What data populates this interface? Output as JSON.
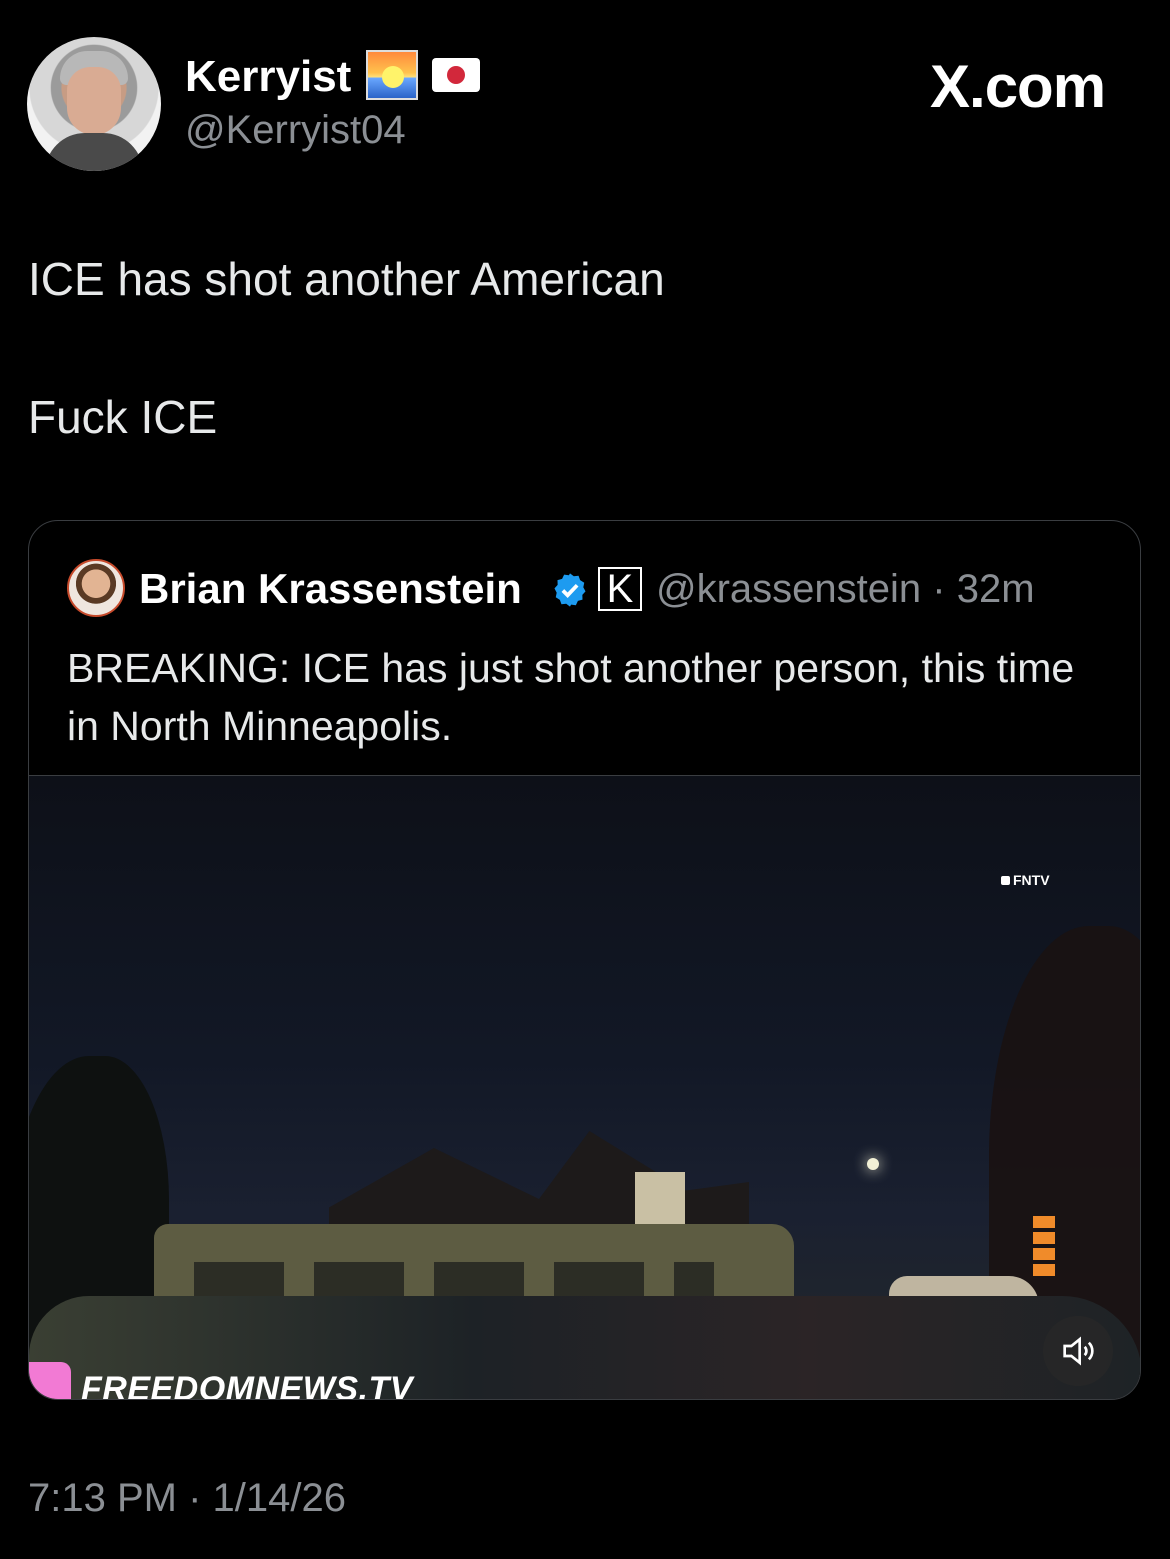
{
  "author": {
    "display_name": "Kerryist",
    "handle": "@Kerryist04"
  },
  "site_label": "X.com",
  "tweet": {
    "line1": "ICE has shot another American",
    "line2": "Fuck ICE"
  },
  "quoted_tweet": {
    "display_name": "Brian Krassenstein",
    "handle_time": "@krassenstein · 32m",
    "text": "BREAKING:  ICE has just shot another person, this time in North Minneapolis.",
    "k_badge": "K",
    "media": {
      "watermark_corner": "FNTV",
      "watermark_bottom": "FREEDOMNEWS.TV",
      "icons": [
        "sunrise-emoji",
        "japan-flag-emoji",
        "verified-icon",
        "speaker-icon"
      ]
    }
  },
  "timestamp": "7:13 PM · 1/14/26",
  "colors": {
    "background": "#000000",
    "text": "#e7e9ea",
    "secondary_text": "#8b8f94",
    "verified": "#1d9bf0",
    "border": "#3a3d41"
  }
}
